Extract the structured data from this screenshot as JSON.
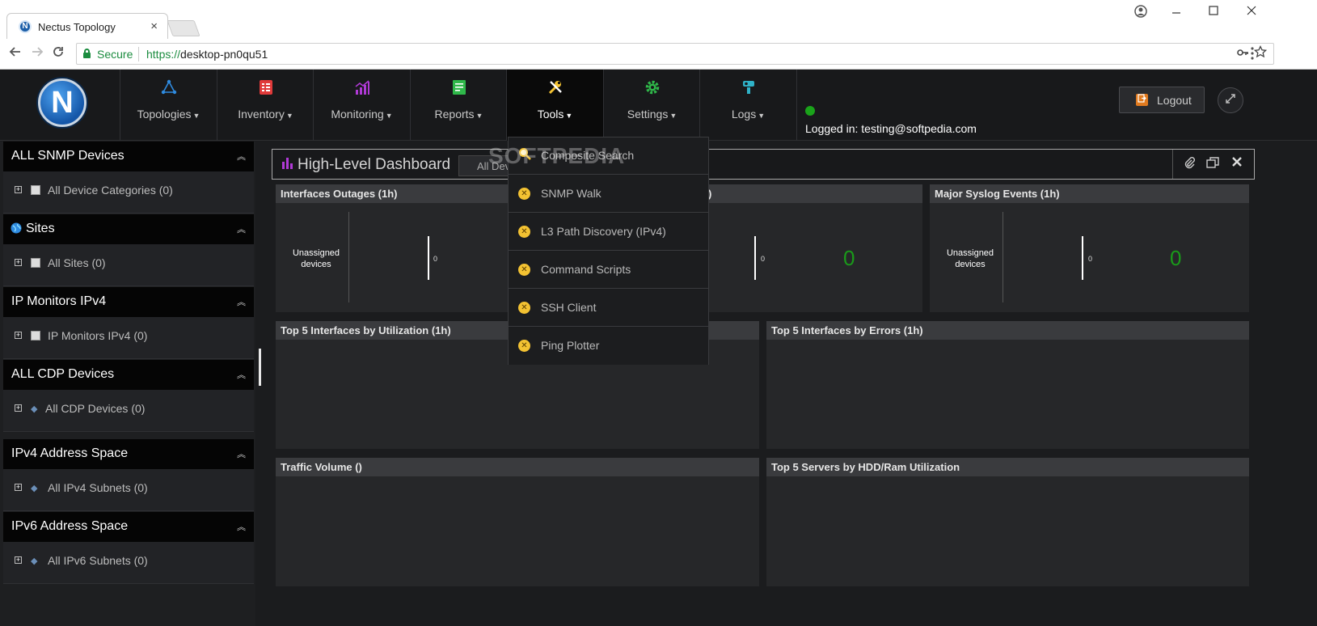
{
  "browser": {
    "tab_title": "Nectus Topology",
    "tab_close": "×",
    "favicon_letter": "N",
    "secure_label": "Secure",
    "url_scheme": "https://",
    "url_host": "desktop-pn0qu51"
  },
  "header": {
    "logo_letter": "N",
    "nav": [
      {
        "label": "Topologies",
        "icon": "topology-icon",
        "color": "#2f8be0"
      },
      {
        "label": "Inventory",
        "icon": "inventory-icon",
        "color": "#e03a3a"
      },
      {
        "label": "Monitoring",
        "icon": "monitoring-icon",
        "color": "#b03ad6"
      },
      {
        "label": "Reports",
        "icon": "reports-icon",
        "color": "#2fb84a"
      },
      {
        "label": "Tools",
        "icon": "tools-icon",
        "color": "#f3c232"
      },
      {
        "label": "Settings",
        "icon": "settings-icon",
        "color": "#2fb84a"
      },
      {
        "label": "Logs",
        "icon": "logs-icon",
        "color": "#2fb2c8"
      }
    ],
    "logged_in": "Logged in: testing@softpedia.com",
    "logout_label": "Logout",
    "status_color": "#1aa31a"
  },
  "sidebar": {
    "sections": [
      {
        "title": "ALL SNMP Devices",
        "item": "All Device Categories (0)"
      },
      {
        "title": "Sites",
        "item": "All Sites (0)"
      },
      {
        "title": "IP Monitors IPv4",
        "item": "IP Monitors IPv4 (0)"
      },
      {
        "title": "ALL CDP Devices",
        "item": "All CDP Devices (0)"
      },
      {
        "title": "IPv4 Address Space",
        "item": "All IPv4 Subnets (0)"
      },
      {
        "title": "IPv6 Address Space",
        "item": "All IPv6 Subnets (0)"
      }
    ]
  },
  "dashboard": {
    "title": "High-Level Dashboard",
    "filter_value": "All Dev",
    "widgets": {
      "interfaces_outages": {
        "title": "Interfaces Outages (1h)",
        "label_line1": "Unassigned",
        "label_line2": "devices",
        "tick": "0"
      },
      "middle_widget": {
        "title_suffix": ")",
        "tick": "0",
        "count": "0"
      },
      "major_syslog": {
        "title": "Major Syslog Events (1h)",
        "label_line1": "Unassigned",
        "label_line2": "devices",
        "tick": "0",
        "count": "0"
      },
      "top5_util": {
        "title": "Top 5 Interfaces by Utilization (1h)"
      },
      "top5_errors": {
        "title": "Top 5 Interfaces by Errors (1h)"
      },
      "traffic_volume": {
        "title": "Traffic Volume ()"
      },
      "top5_servers": {
        "title": "Top 5 Servers by HDD/Ram Utilization"
      }
    }
  },
  "tools_menu": {
    "items": [
      "Composite Search",
      "SNMP Walk",
      "L3 Path Discovery (IPv4)",
      "Command Scripts",
      "SSH Client",
      "Ping Plotter"
    ]
  },
  "watermark": "SOFTPEDIA",
  "colors": {
    "accent_green": "#1a9a1a",
    "menu_icon": "#f3c232",
    "logout_icon": "#e07a1f"
  }
}
